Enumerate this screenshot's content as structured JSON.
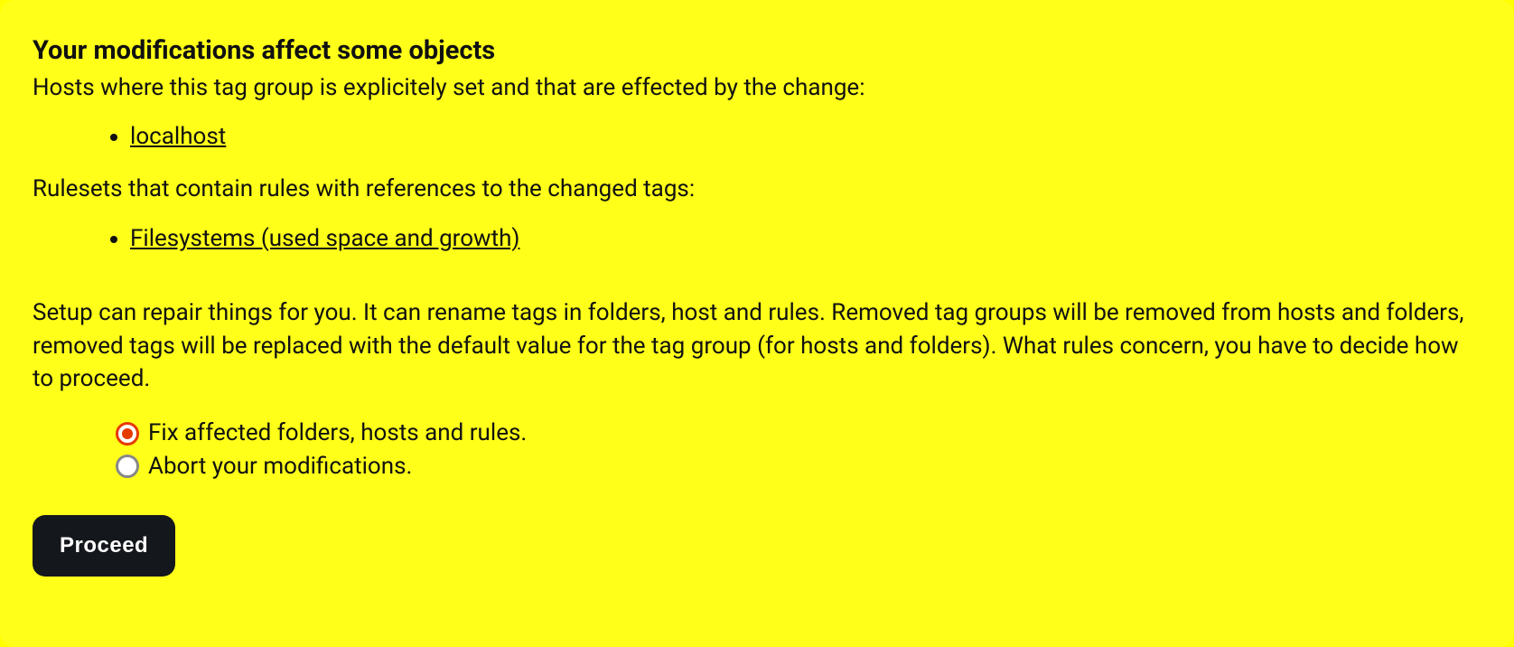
{
  "dialog": {
    "heading": "Your modifications affect some objects",
    "hosts_intro": "Hosts where this tag group is explicitely set and that are effected by the change:",
    "hosts": [
      "localhost"
    ],
    "rulesets_intro": "Rulesets that contain rules with references to the changed tags:",
    "rulesets": [
      "Filesystems (used space and growth)"
    ],
    "explain": "Setup can repair things for you. It can rename tags in folders, host and rules. Removed tag groups will be removed from hosts and folders, removed tags will be replaced with the default value for the tag group (for hosts and folders). What rules concern, you have to decide how to proceed.",
    "options": {
      "fix": "Fix affected folders, hosts and rules.",
      "abort": "Abort your modifications."
    },
    "selected_option": "fix",
    "proceed_label": "Proceed"
  }
}
